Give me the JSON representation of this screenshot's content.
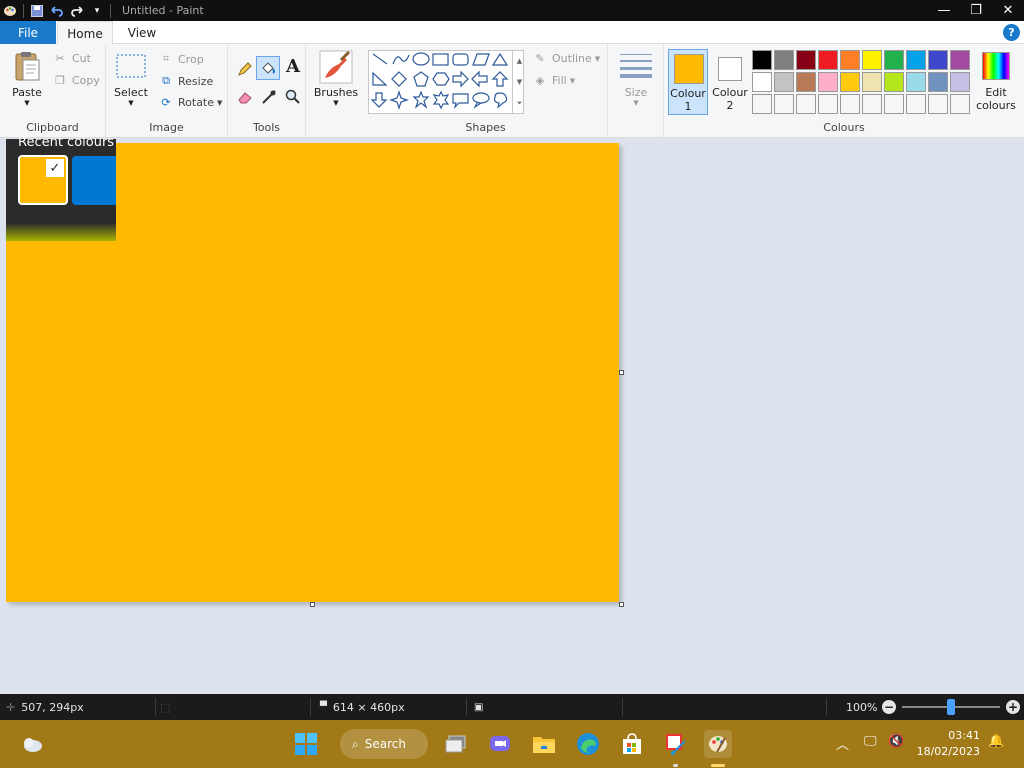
{
  "titlebar": {
    "title": "Untitled - Paint",
    "minimize": "—",
    "restore": "❐",
    "close": "✕"
  },
  "tabs": {
    "file": "File",
    "home": "Home",
    "view": "View",
    "help": "?"
  },
  "clipboard": {
    "paste": "Paste",
    "cut": "Cut",
    "copy": "Copy",
    "label": "Clipboard"
  },
  "image": {
    "select": "Select",
    "crop": "Crop",
    "resize": "Resize",
    "rotate": "Rotate",
    "label": "Image"
  },
  "tools": {
    "label": "Tools",
    "text_glyph": "A"
  },
  "brushes": {
    "label": "Brushes"
  },
  "shapes": {
    "label": "Shapes",
    "outline": "Outline",
    "fill": "Fill"
  },
  "size": {
    "label": "Size"
  },
  "colours": {
    "colour1_label": "Colour",
    "colour1_num": "1",
    "colour2_label": "Colour",
    "colour2_num": "2",
    "edit_label": "Edit",
    "edit_label2": "colours",
    "label": "Colours",
    "colour1": "#ffb900",
    "colour2": "#ffffff",
    "palette_row1": [
      "#000000",
      "#7f7f7f",
      "#880015",
      "#ed1c24",
      "#ff7f27",
      "#fff200",
      "#22b14c",
      "#00a2e8",
      "#3f48cc",
      "#a349a4"
    ],
    "palette_row2": [
      "#ffffff",
      "#c3c3c3",
      "#b97a57",
      "#ffaec9",
      "#ffc90e",
      "#efe4b0",
      "#b5e61d",
      "#99d9ea",
      "#7092be",
      "#c8bfe7"
    ],
    "palette_row3": [
      "#f5f6f7",
      "#f5f6f7",
      "#f5f6f7",
      "#f5f6f7",
      "#f5f6f7",
      "#f5f6f7",
      "#f5f6f7",
      "#f5f6f7",
      "#f5f6f7",
      "#f5f6f7"
    ]
  },
  "recent": {
    "title": "Recent colours",
    "check": "✓",
    "color1": "#ffb900",
    "color2": "#0078d4"
  },
  "canvas": {
    "fill": "#ffb900"
  },
  "status": {
    "cursor_pos": "507, 294px",
    "canvas_size": "614 × 460px",
    "zoom": "100%",
    "zoom_minus": "−",
    "zoom_plus": "+"
  },
  "taskbar": {
    "search": "Search",
    "time": "03:41",
    "date": "18/02/2023"
  }
}
